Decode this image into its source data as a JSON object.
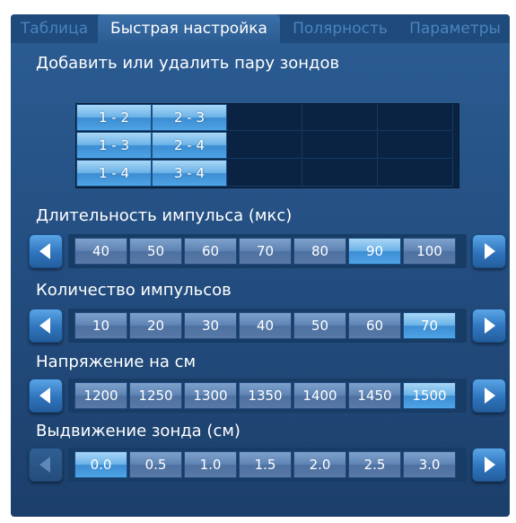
{
  "tabs": [
    {
      "label": "Таблица",
      "active": false
    },
    {
      "label": "Быстрая настройка",
      "active": true
    },
    {
      "label": "Полярность",
      "active": false
    },
    {
      "label": "Параметры",
      "active": false
    }
  ],
  "probe_pairs": {
    "title": "Добавить или удалить пару зондов",
    "cells": [
      [
        "1 - 2",
        "2 - 3",
        "",
        "",
        ""
      ],
      [
        "1 - 3",
        "2 - 4",
        "",
        "",
        ""
      ],
      [
        "1 - 4",
        "3 - 4",
        "",
        "",
        ""
      ]
    ]
  },
  "pulse_duration": {
    "title": "Длительность импульса (мкс)",
    "options": [
      "40",
      "50",
      "60",
      "70",
      "80",
      "90",
      "100"
    ],
    "selected": "90"
  },
  "pulse_count": {
    "title": "Количество импульсов",
    "options": [
      "10",
      "20",
      "30",
      "40",
      "50",
      "60",
      "70"
    ],
    "selected": "70"
  },
  "voltage": {
    "title": "Напряжение на см",
    "options": [
      "1200",
      "1250",
      "1300",
      "1350",
      "1400",
      "1450",
      "1500"
    ],
    "selected": "1500"
  },
  "probe_extension": {
    "title": "Выдвижение зонда (см)",
    "options": [
      "0.0",
      "0.5",
      "1.0",
      "1.5",
      "2.0",
      "2.5",
      "3.0"
    ],
    "selected": "0.0"
  },
  "colors": {
    "panel": "#244f82",
    "selected": "#4ea4e4",
    "unselected": "#5f84b4",
    "inactive_tab_text": "#4a84c0"
  },
  "icons": {
    "left": "arrow-left-icon",
    "right": "arrow-right-icon"
  }
}
